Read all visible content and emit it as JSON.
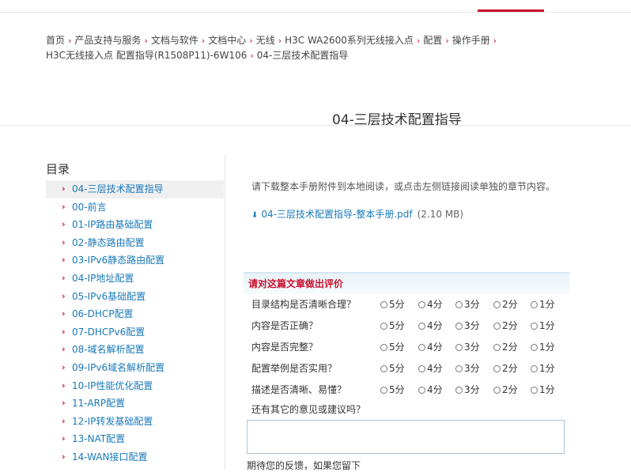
{
  "breadcrumb": [
    "首页",
    "产品支持与服务",
    "文档与软件",
    "文档中心",
    "无线",
    "H3C WA2600系列无线接入点",
    "配置",
    "操作手册",
    "H3C无线接入点 配置指导(R1508P11)-6W106",
    "04-三层技术配置指导"
  ],
  "page_title": "04-三层技术配置指导",
  "toc": {
    "heading": "目录",
    "items": [
      "04-三层技术配置指导",
      "00-前言",
      "01-IP路由基础配置",
      "02-静态路由配置",
      "03-IPv6静态路由配置",
      "04-IP地址配置",
      "05-IPv6基础配置",
      "06-DHCP配置",
      "07-DHCPv6配置",
      "08-域名解析配置",
      "09-IPv6域名解析配置",
      "10-IP性能优化配置",
      "11-ARP配置",
      "12-IP转发基础配置",
      "13-NAT配置",
      "14-WAN接口配置"
    ],
    "active_index": 0
  },
  "intro": "请下载整本手册附件到本地阅读，或点击左侧链接阅读单独的章节内容。",
  "download": {
    "link": "04-三层技术配置指导-整本手册.pdf",
    "size": "(2.10 MB)",
    "icon": "download-icon"
  },
  "rating": {
    "header": "请对这篇文章做出评价",
    "options": [
      "5分",
      "4分",
      "3分",
      "2分",
      "1分"
    ],
    "questions": [
      "目录结构是否清晰合理？",
      "内容是否正确？",
      "内容是否完整？",
      "配置举例是否实用？",
      "描述是否清晰、易懂？"
    ],
    "other": "还有其它的意见或建议吗？",
    "footer": "期待您的反馈，如果您留下"
  },
  "colors": {
    "accent": "#c8102e",
    "link": "#1a79b8"
  }
}
